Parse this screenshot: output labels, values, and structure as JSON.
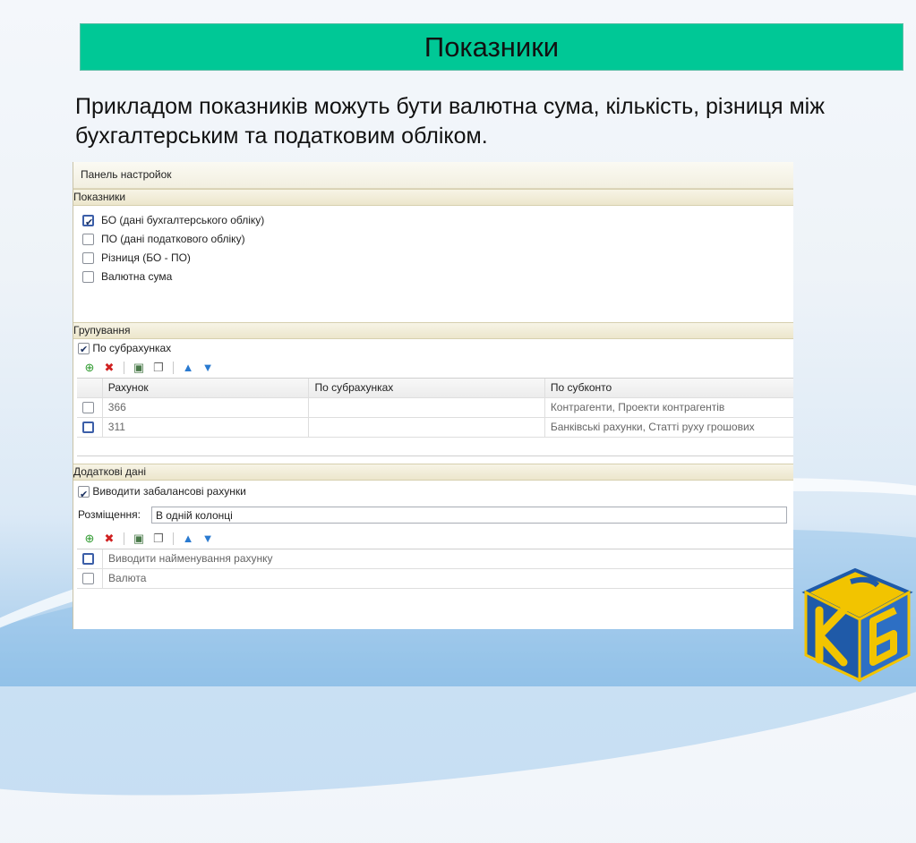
{
  "slide": {
    "title": "Показники",
    "description": "Прикладом показників можуть бути валютна сума, кількість, різниця між бухгалтерським та податковим обліком."
  },
  "panel": {
    "header": "Панель настройок",
    "indicators": {
      "title": "Показники",
      "options": [
        {
          "label": "БО (дані бухгалтерського обліку)",
          "checked": true
        },
        {
          "label": "ПО (дані податкового обліку)",
          "checked": false
        },
        {
          "label": "Різниця (БО - ПО)",
          "checked": false
        },
        {
          "label": "Валютна сума",
          "checked": false
        }
      ]
    },
    "grouping": {
      "title": "Групування",
      "by_subaccounts_label": "По субрахунках",
      "by_subaccounts_checked": true,
      "columns": [
        "Рахунок",
        "По субрахунках",
        "По субконто"
      ],
      "rows": [
        {
          "account": "366",
          "subaccounts": "",
          "subconto": "Контрагенти, Проекти контрагентів"
        },
        {
          "account": "311",
          "subaccounts": "",
          "subconto": "Банківські рахунки, Статті руху грошових"
        }
      ]
    },
    "additional": {
      "title": "Додаткові дані",
      "offbalance_label": "Виводити забалансові рахунки",
      "offbalance_checked": true,
      "placement_label": "Розміщення:",
      "placement_value": "В одній колонці",
      "rows": [
        {
          "label": "Виводити найменування рахунку"
        },
        {
          "label": "Валюта"
        }
      ]
    }
  },
  "colors": {
    "title_bar": "#00c896",
    "panel_section": "#ece6cc",
    "logo_blue": "#1f5aa8",
    "logo_yellow": "#f2c400"
  }
}
